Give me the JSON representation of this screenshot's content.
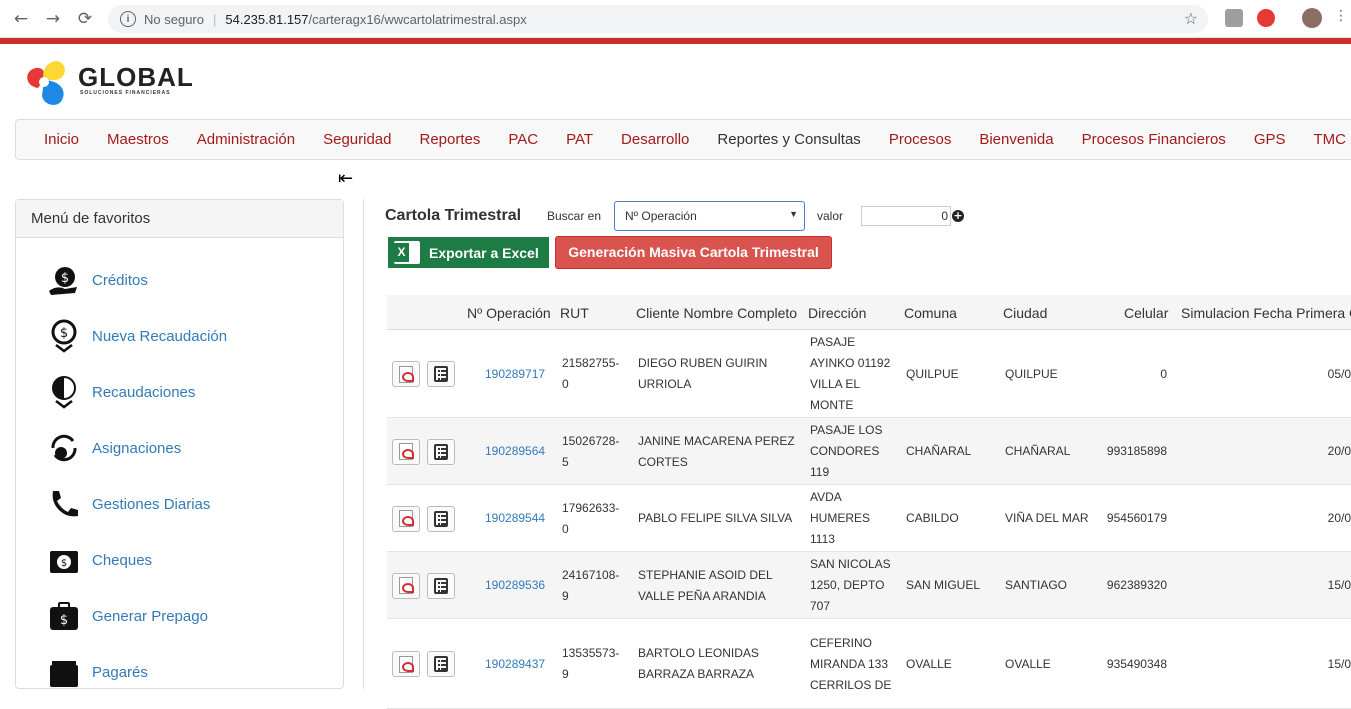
{
  "browser": {
    "security": "No seguro",
    "host": "54.235.81.157",
    "path": "/carteragx16/wwcartolatrimestral.aspx",
    "back": "←",
    "forward": "→",
    "reload": "⟳"
  },
  "logo": {
    "name": "GLOBAL",
    "tagline": "SOLUCIONES FINANCIERAS"
  },
  "nav": [
    "Inicio",
    "Maestros",
    "Administración",
    "Seguridad",
    "Reportes",
    "PAC",
    "PAT",
    "Desarrollo",
    "Reportes y Consultas",
    "Procesos",
    "Bienvenida",
    "Procesos Financieros",
    "GPS",
    "TMC"
  ],
  "sidebar": {
    "title": "Menú de favoritos",
    "items": [
      {
        "label": "Créditos",
        "icon": "money-hand-icon"
      },
      {
        "label": "Nueva Recaudación",
        "icon": "money-down-icon"
      },
      {
        "label": "Recaudaciones",
        "icon": "money-down-half-icon"
      },
      {
        "label": "Asignaciones",
        "icon": "refresh-money-icon"
      },
      {
        "label": "Gestiones Diarias",
        "icon": "phone-icon"
      },
      {
        "label": "Cheques",
        "icon": "cash-icon"
      },
      {
        "label": "Generar Prepago",
        "icon": "wallet-icon"
      },
      {
        "label": "Pagarés",
        "icon": "cash-stack-icon"
      }
    ]
  },
  "page": {
    "title": "Cartola Trimestral",
    "search_label": "Buscar en",
    "search_select": "Nº Operación",
    "value_label": "valor",
    "value": "0",
    "export_label": "Exportar a Excel",
    "mass_label": "Generación Masiva Cartola Trimestral"
  },
  "table": {
    "headers": [
      "Nº Operación",
      "RUT",
      "Cliente Nombre Completo",
      "Dirección",
      "Comuna",
      "Ciudad",
      "Celular",
      "Simulacion Fecha Primera C"
    ],
    "rows": [
      {
        "op": "190289717",
        "rut": [
          "21582755-",
          "0"
        ],
        "name": [
          "DIEGO RUBEN GUIRIN",
          "URRIOLA"
        ],
        "dir": [
          "PASAJE",
          "AYINKO 01192",
          "VILLA EL",
          "MONTE"
        ],
        "comuna": "QUILPUE",
        "ciudad": "QUILPUE",
        "celular": "0",
        "fecha": "05/0"
      },
      {
        "op": "190289564",
        "rut": [
          "15026728-",
          "5"
        ],
        "name": [
          "JANINE MACARENA PEREZ",
          "CORTES"
        ],
        "dir": [
          "PASAJE LOS",
          "CONDORES",
          "119"
        ],
        "comuna": "CHAÑARAL",
        "ciudad": "CHAÑARAL",
        "celular": "993185898",
        "fecha": "20/0"
      },
      {
        "op": "190289544",
        "rut": [
          "17962633-",
          "0"
        ],
        "name": [
          "PABLO FELIPE SILVA SILVA"
        ],
        "dir": [
          "AVDA",
          "HUMERES",
          "1113"
        ],
        "comuna": "CABILDO",
        "ciudad": "VIÑA DEL MAR",
        "celular": "954560179",
        "fecha": "20/0"
      },
      {
        "op": "190289536",
        "rut": [
          "24167108-",
          "9"
        ],
        "name": [
          "STEPHANIE ASOID DEL",
          "VALLE PEÑA ARANDIA"
        ],
        "dir": [
          "SAN NICOLAS",
          "1250, DEPTO",
          "707"
        ],
        "comuna": "SAN MIGUEL",
        "ciudad": "SANTIAGO",
        "celular": "962389320",
        "fecha": "15/0"
      },
      {
        "op": "190289437",
        "rut": [
          "13535573-",
          "9"
        ],
        "name": [
          "BARTOLO LEONIDAS",
          "BARRAZA BARRAZA"
        ],
        "dir": [
          "CEFERINO",
          "MIRANDA 133",
          "CERRILOS DE"
        ],
        "comuna": "OVALLE",
        "ciudad": "OVALLE",
        "celular": "935490348",
        "fecha": "15/0"
      }
    ]
  },
  "colors": {
    "accent_red": "#c9302c",
    "link_blue": "#337ab7",
    "nav_red": "#a31a1a",
    "excel_green": "#1d7b44",
    "danger": "#d9534f"
  }
}
